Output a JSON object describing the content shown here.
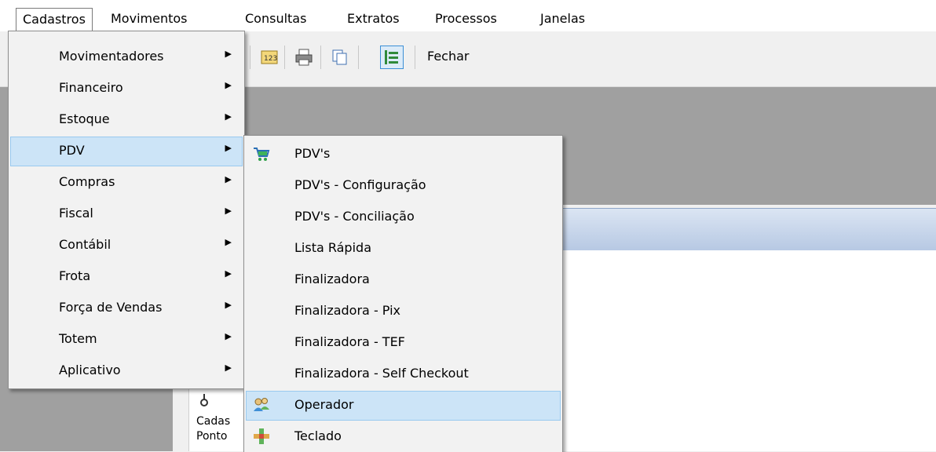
{
  "menubar": {
    "items": [
      {
        "label": "Cadastros"
      },
      {
        "label": "Movimentos"
      },
      {
        "label": "Consultas"
      },
      {
        "label": "Extratos"
      },
      {
        "label": "Processos"
      },
      {
        "label": "Janelas"
      }
    ]
  },
  "toolbar": {
    "close_label": "Fechar"
  },
  "content": {
    "label_line1": "Cadas",
    "label_line2": "Ponto"
  },
  "cadastros_menu": {
    "items": [
      {
        "label": "Movimentadores"
      },
      {
        "label": "Financeiro"
      },
      {
        "label": "Estoque"
      },
      {
        "label": "PDV"
      },
      {
        "label": "Compras"
      },
      {
        "label": "Fiscal"
      },
      {
        "label": "Contábil"
      },
      {
        "label": "Frota"
      },
      {
        "label": "Força de Vendas"
      },
      {
        "label": "Totem"
      },
      {
        "label": "Aplicativo"
      }
    ],
    "highlighted": "PDV"
  },
  "pdv_menu": {
    "items": [
      {
        "label": "PDV's",
        "icon": "cart-icon"
      },
      {
        "label": "PDV's - Configuração"
      },
      {
        "label": "PDV's - Conciliação"
      },
      {
        "label": "Lista Rápida"
      },
      {
        "label": "Finalizadora"
      },
      {
        "label": "Finalizadora - Pix"
      },
      {
        "label": "Finalizadora - TEF"
      },
      {
        "label": "Finalizadora - Self Checkout"
      },
      {
        "label": "Operador",
        "icon": "users-icon"
      },
      {
        "label": "Teclado",
        "icon": "keyboard-icon"
      }
    ],
    "highlighted": "Operador"
  },
  "colors": {
    "highlight_bg": "#cce4f7",
    "highlight_border": "#99c9ef",
    "workspace_gray": "#a0a0a0"
  }
}
